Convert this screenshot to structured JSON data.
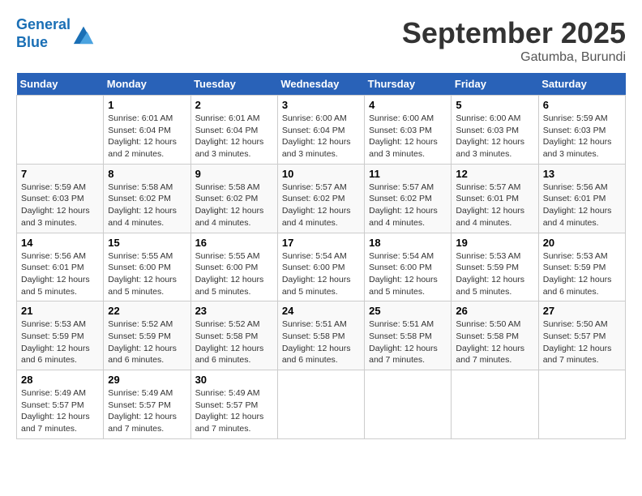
{
  "logo": {
    "line1": "General",
    "line2": "Blue"
  },
  "title": "September 2025",
  "subtitle": "Gatumba, Burundi",
  "days_of_week": [
    "Sunday",
    "Monday",
    "Tuesday",
    "Wednesday",
    "Thursday",
    "Friday",
    "Saturday"
  ],
  "weeks": [
    [
      {
        "day": "",
        "info": ""
      },
      {
        "day": "1",
        "info": "Sunrise: 6:01 AM\nSunset: 6:04 PM\nDaylight: 12 hours\nand 2 minutes."
      },
      {
        "day": "2",
        "info": "Sunrise: 6:01 AM\nSunset: 6:04 PM\nDaylight: 12 hours\nand 3 minutes."
      },
      {
        "day": "3",
        "info": "Sunrise: 6:00 AM\nSunset: 6:04 PM\nDaylight: 12 hours\nand 3 minutes."
      },
      {
        "day": "4",
        "info": "Sunrise: 6:00 AM\nSunset: 6:03 PM\nDaylight: 12 hours\nand 3 minutes."
      },
      {
        "day": "5",
        "info": "Sunrise: 6:00 AM\nSunset: 6:03 PM\nDaylight: 12 hours\nand 3 minutes."
      },
      {
        "day": "6",
        "info": "Sunrise: 5:59 AM\nSunset: 6:03 PM\nDaylight: 12 hours\nand 3 minutes."
      }
    ],
    [
      {
        "day": "7",
        "info": "Sunrise: 5:59 AM\nSunset: 6:03 PM\nDaylight: 12 hours\nand 3 minutes."
      },
      {
        "day": "8",
        "info": "Sunrise: 5:58 AM\nSunset: 6:02 PM\nDaylight: 12 hours\nand 4 minutes."
      },
      {
        "day": "9",
        "info": "Sunrise: 5:58 AM\nSunset: 6:02 PM\nDaylight: 12 hours\nand 4 minutes."
      },
      {
        "day": "10",
        "info": "Sunrise: 5:57 AM\nSunset: 6:02 PM\nDaylight: 12 hours\nand 4 minutes."
      },
      {
        "day": "11",
        "info": "Sunrise: 5:57 AM\nSunset: 6:02 PM\nDaylight: 12 hours\nand 4 minutes."
      },
      {
        "day": "12",
        "info": "Sunrise: 5:57 AM\nSunset: 6:01 PM\nDaylight: 12 hours\nand 4 minutes."
      },
      {
        "day": "13",
        "info": "Sunrise: 5:56 AM\nSunset: 6:01 PM\nDaylight: 12 hours\nand 4 minutes."
      }
    ],
    [
      {
        "day": "14",
        "info": "Sunrise: 5:56 AM\nSunset: 6:01 PM\nDaylight: 12 hours\nand 5 minutes."
      },
      {
        "day": "15",
        "info": "Sunrise: 5:55 AM\nSunset: 6:00 PM\nDaylight: 12 hours\nand 5 minutes."
      },
      {
        "day": "16",
        "info": "Sunrise: 5:55 AM\nSunset: 6:00 PM\nDaylight: 12 hours\nand 5 minutes."
      },
      {
        "day": "17",
        "info": "Sunrise: 5:54 AM\nSunset: 6:00 PM\nDaylight: 12 hours\nand 5 minutes."
      },
      {
        "day": "18",
        "info": "Sunrise: 5:54 AM\nSunset: 6:00 PM\nDaylight: 12 hours\nand 5 minutes."
      },
      {
        "day": "19",
        "info": "Sunrise: 5:53 AM\nSunset: 5:59 PM\nDaylight: 12 hours\nand 5 minutes."
      },
      {
        "day": "20",
        "info": "Sunrise: 5:53 AM\nSunset: 5:59 PM\nDaylight: 12 hours\nand 6 minutes."
      }
    ],
    [
      {
        "day": "21",
        "info": "Sunrise: 5:53 AM\nSunset: 5:59 PM\nDaylight: 12 hours\nand 6 minutes."
      },
      {
        "day": "22",
        "info": "Sunrise: 5:52 AM\nSunset: 5:59 PM\nDaylight: 12 hours\nand 6 minutes."
      },
      {
        "day": "23",
        "info": "Sunrise: 5:52 AM\nSunset: 5:58 PM\nDaylight: 12 hours\nand 6 minutes."
      },
      {
        "day": "24",
        "info": "Sunrise: 5:51 AM\nSunset: 5:58 PM\nDaylight: 12 hours\nand 6 minutes."
      },
      {
        "day": "25",
        "info": "Sunrise: 5:51 AM\nSunset: 5:58 PM\nDaylight: 12 hours\nand 7 minutes."
      },
      {
        "day": "26",
        "info": "Sunrise: 5:50 AM\nSunset: 5:58 PM\nDaylight: 12 hours\nand 7 minutes."
      },
      {
        "day": "27",
        "info": "Sunrise: 5:50 AM\nSunset: 5:57 PM\nDaylight: 12 hours\nand 7 minutes."
      }
    ],
    [
      {
        "day": "28",
        "info": "Sunrise: 5:49 AM\nSunset: 5:57 PM\nDaylight: 12 hours\nand 7 minutes."
      },
      {
        "day": "29",
        "info": "Sunrise: 5:49 AM\nSunset: 5:57 PM\nDaylight: 12 hours\nand 7 minutes."
      },
      {
        "day": "30",
        "info": "Sunrise: 5:49 AM\nSunset: 5:57 PM\nDaylight: 12 hours\nand 7 minutes."
      },
      {
        "day": "",
        "info": ""
      },
      {
        "day": "",
        "info": ""
      },
      {
        "day": "",
        "info": ""
      },
      {
        "day": "",
        "info": ""
      }
    ]
  ]
}
